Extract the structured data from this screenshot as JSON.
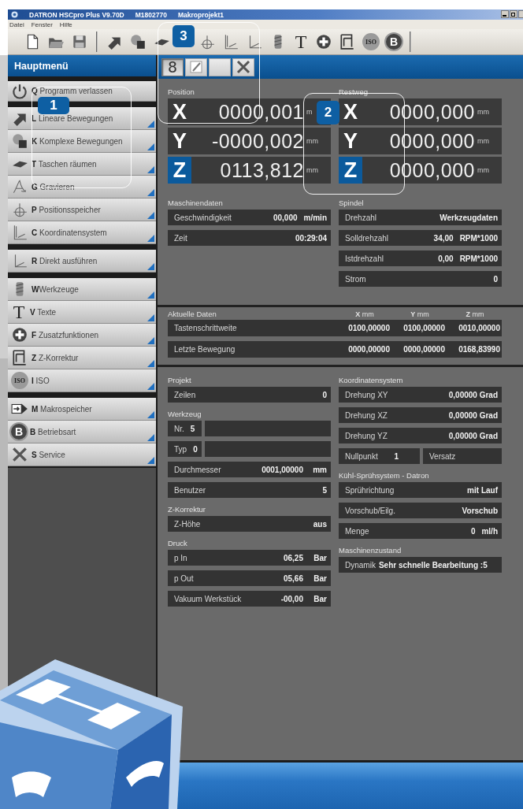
{
  "window": {
    "title_parts": [
      "DATRON HSCpro Plus V9.70D",
      "M1802770",
      "Makroprojekt1"
    ]
  },
  "menu": [
    "Datei",
    "Fenster",
    "Hilfe"
  ],
  "toolbar": [
    [
      {
        "kind": "new"
      },
      {
        "kind": "open"
      },
      {
        "kind": "save"
      }
    ],
    [
      {
        "kind": "arrow"
      },
      {
        "kind": "shapes"
      },
      {
        "kind": "pocket"
      },
      {
        "kind": "crosshair"
      },
      {
        "kind": "axes"
      },
      {
        "kind": "axes2"
      },
      {
        "kind": "drill"
      },
      {
        "kind": "glyph-t",
        "glyph": "T"
      },
      {
        "kind": "plus"
      },
      {
        "kind": "zframe"
      },
      {
        "kind": "glyph-iso",
        "glyph": "ISO"
      },
      {
        "kind": "glyph-b",
        "glyph": "B"
      }
    ]
  ],
  "sidebar": {
    "title": "Hauptmenü",
    "groups": [
      {
        "items": [
          {
            "kind": "power",
            "text": "**Q** Programm verlassen",
            "submenu": false
          }
        ]
      },
      {
        "items": [
          {
            "kind": "arrow",
            "text": "**L** Lineare Bewegungen",
            "submenu": true
          },
          {
            "kind": "shapes",
            "text": "**K** Komplexe Bewegungen",
            "submenu": true
          },
          {
            "kind": "pocket",
            "text": "**T** Taschen räumen",
            "submenu": true
          },
          {
            "kind": "engrave",
            "text": "**G** Gravieren",
            "submenu": true
          },
          {
            "kind": "crosshair",
            "text": "**P** Positionsspeicher",
            "submenu": true
          },
          {
            "kind": "axes",
            "text": "**C** Koordinatensystem",
            "submenu": true
          }
        ]
      },
      {
        "items": [
          {
            "kind": "axes2",
            "text": "**R** Direkt ausführen",
            "submenu": true
          }
        ]
      },
      {
        "items": [
          {
            "kind": "drill",
            "text": "**W**Werkzeuge",
            "submenu": true
          },
          {
            "kind": "glyph-t",
            "glyph": "T",
            "text": "**V** Texte",
            "submenu": true
          },
          {
            "kind": "plus",
            "text": "**F** Zusatzfunktionen",
            "submenu": true
          },
          {
            "kind": "zframe",
            "text": "**Z** Z-Korrektur",
            "submenu": true
          },
          {
            "kind": "glyph-iso",
            "glyph": "ISO",
            "text": "**I** ISO",
            "submenu": true
          }
        ]
      },
      {
        "items": [
          {
            "kind": "macro",
            "text": "**M** Makrospeicher",
            "submenu": true
          },
          {
            "kind": "glyph-b",
            "glyph": "B",
            "text": "**B** Betriebsart",
            "submenu": true
          },
          {
            "kind": "tools",
            "text": "**S** Service",
            "submenu": true
          }
        ]
      }
    ]
  },
  "content_tabs": [
    {
      "kind": "digit",
      "glyph": "8",
      "selected": true
    },
    {
      "kind": "pencil",
      "selected": false
    },
    {
      "kind": "blank",
      "selected": false
    },
    {
      "kind": "tools",
      "selected": false
    }
  ],
  "position": {
    "title": "Position",
    "rows": [
      {
        "axis": "X",
        "value": "0000,001",
        "unit": "m",
        "highlighted": false
      },
      {
        "axis": "Y",
        "value": "-0000,002",
        "unit": "mm",
        "highlighted": false
      },
      {
        "axis": "Z",
        "value": "0113,812",
        "unit": "mm",
        "highlighted": true
      }
    ]
  },
  "restweg": {
    "title": "Restweg",
    "rows": [
      {
        "axis": "X",
        "value": "0000,000",
        "unit": "mm",
        "highlighted": false
      },
      {
        "axis": "Y",
        "value": "0000,000",
        "unit": "mm",
        "highlighted": false
      },
      {
        "axis": "Z",
        "value": "0000,000",
        "unit": "mm",
        "highlighted": true
      }
    ]
  },
  "upper_groups": [
    [
      {
        "title": "Maschinendaten",
        "rows": [
          {
            "kind": "field",
            "label": "Geschwindigkeit",
            "value": "00,000",
            "unit": "m/min"
          },
          {
            "kind": "field",
            "label": "Zeit",
            "value": "00:29:04"
          }
        ]
      }
    ],
    [
      {
        "title": "Spindel",
        "rows": [
          {
            "kind": "field",
            "label": "Drehzahl",
            "value": "Werkzeugdaten"
          },
          {
            "kind": "field",
            "label": "Solldrehzahl",
            "value": "34,00",
            "unit": "RPM*1000"
          },
          {
            "kind": "field",
            "label": "Istdrehzahl",
            "value": "0,00",
            "unit": "RPM*1000"
          },
          {
            "kind": "field",
            "label": "Strom",
            "value": "0"
          }
        ]
      }
    ]
  ],
  "aktuelle_daten": {
    "title": "Aktuelle Daten",
    "columns": [
      "**X** mm",
      "**Y** mm",
      "**Z** mm"
    ],
    "rows": [
      {
        "label": "Tastenschrittweite",
        "values": [
          "0100,00000",
          "0100,00000",
          "0010,00000"
        ]
      },
      {
        "label": "Letzte Bewegung",
        "values": [
          "0000,00000",
          "0000,00000",
          "0168,83990"
        ]
      }
    ]
  },
  "lower_groups": [
    [
      {
        "title": "Projekt",
        "rows": [
          {
            "kind": "field",
            "label": "Zeilen",
            "value": "0"
          }
        ]
      },
      {
        "title": "Werkzeug",
        "rows": [
          {
            "kind": "tag",
            "label": "Nr.",
            "value": "5"
          },
          {
            "kind": "tag",
            "label": "Typ",
            "value": "0"
          },
          {
            "kind": "field",
            "label": "Durchmesser",
            "value": "0001,00000",
            "unit": "mm"
          },
          {
            "kind": "field",
            "label": "Benutzer",
            "value": "5"
          }
        ]
      },
      {
        "title": "Z-Korrektur",
        "rows": [
          {
            "kind": "field",
            "label": "Z-Höhe",
            "value": "aus"
          }
        ]
      },
      {
        "title": "Druck",
        "rows": [
          {
            "kind": "field",
            "label": "p In",
            "value": "06,25",
            "unit": "Bar"
          },
          {
            "kind": "field",
            "label": "p Out",
            "value": "05,66",
            "unit": "Bar"
          },
          {
            "kind": "field",
            "label": "Vakuum Werkstück",
            "value": "-00,00",
            "unit": "Bar"
          }
        ]
      }
    ],
    [
      {
        "title": "Koordinatensystem",
        "rows": [
          {
            "kind": "field",
            "label": "Drehung XY",
            "value": "0,00000 Grad"
          },
          {
            "kind": "field",
            "label": "Drehung XZ",
            "value": "0,00000 Grad"
          },
          {
            "kind": "field",
            "label": "Drehung YZ",
            "value": "0,00000 Grad"
          },
          {
            "kind": "split",
            "label": "Nullpunkt",
            "value": "1",
            "extra": "Versatz"
          }
        ]
      },
      {
        "title": "Kühl-Sprühsystem - Datron",
        "rows": [
          {
            "kind": "field",
            "label": "Sprührichtung",
            "value": "mit Lauf"
          },
          {
            "kind": "field",
            "label": "Vorschub/Eilg.",
            "value": "Vorschub"
          },
          {
            "kind": "field",
            "label": "Menge",
            "value": "0",
            "unit": "ml/h"
          }
        ]
      },
      {
        "title": "Maschinenzustand",
        "rows": [
          {
            "kind": "inline",
            "label": "Dynamik",
            "value": "Sehr schnelle Bearbeitung :5"
          }
        ]
      }
    ]
  ],
  "callouts": [
    {
      "number": "1"
    },
    {
      "number": "2"
    },
    {
      "number": "3"
    }
  ]
}
